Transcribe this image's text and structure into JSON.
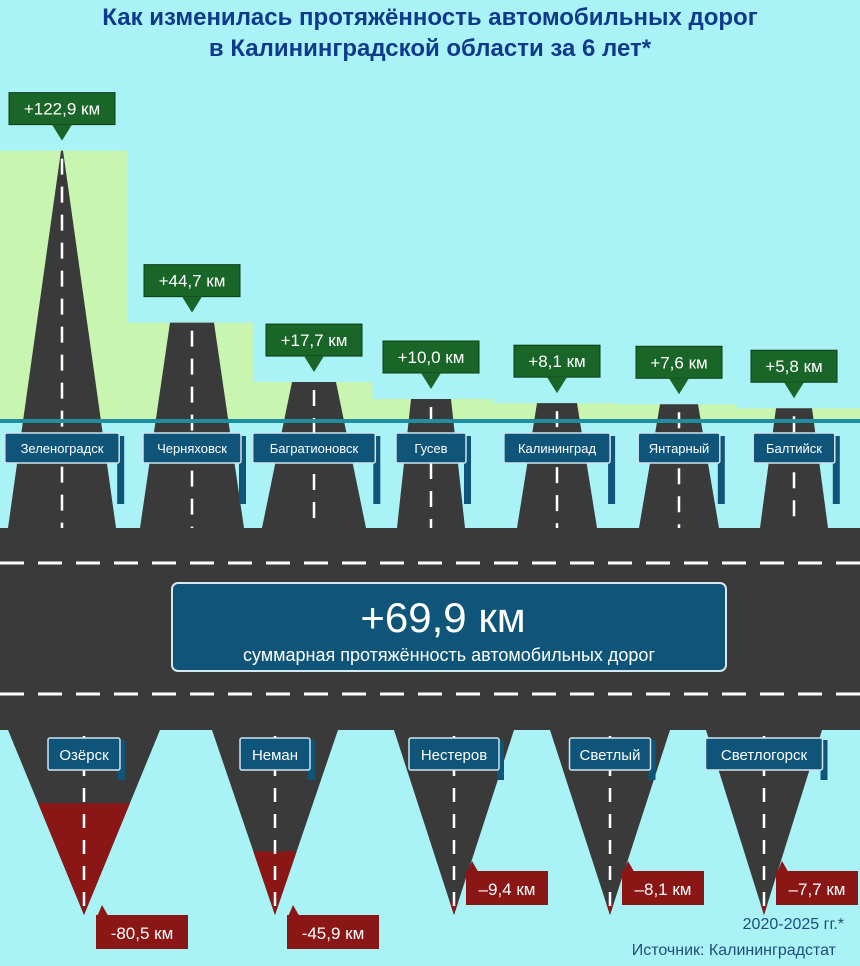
{
  "title_line1": "Как изменилась протяжённость автомобильных дорог",
  "title_line2": "в Калининградской области за 6 лет*",
  "total": {
    "value": "+69,9 км",
    "label": "суммарная протяжённость автомобильных дорог"
  },
  "colors": {
    "background": "#a9f3f7",
    "growth_area": "#c8f5b0",
    "road": "#3a3a3a",
    "positive_label": "#1a6628",
    "negative_label": "#8a1616",
    "sign": "#0f5579",
    "baseline": "#1e8fa0"
  },
  "chart_data": {
    "type": "bar",
    "unit": "км",
    "period": "2020-2025 гг.*",
    "increases": [
      {
        "city": "Зеленоградск",
        "value": 122.9,
        "label": "+122,9 км"
      },
      {
        "city": "Черняховск",
        "value": 44.7,
        "label": "+44,7 км"
      },
      {
        "city": "Багратионовск",
        "value": 17.7,
        "label": "+17,7 км"
      },
      {
        "city": "Гусев",
        "value": 10.0,
        "label": "+10,0 км"
      },
      {
        "city": "Калининград",
        "value": 8.1,
        "label": "+8,1 км"
      },
      {
        "city": "Янтарный",
        "value": 7.6,
        "label": "+7,6 км"
      },
      {
        "city": "Балтийск",
        "value": 5.8,
        "label": "+5,8 км"
      }
    ],
    "decreases": [
      {
        "city": "Озёрск",
        "value": -80.5,
        "label": "-80,5 км"
      },
      {
        "city": "Неман",
        "value": -45.9,
        "label": "-45,9 км"
      },
      {
        "city": "Нестеров",
        "value": -9.4,
        "label": "–9,4 км"
      },
      {
        "city": "Светлый",
        "value": -8.1,
        "label": "–8,1 км"
      },
      {
        "city": "Светлогорск",
        "value": -7.7,
        "label": "–7,7 км"
      }
    ]
  },
  "footer": {
    "period": "2020-2025 гг.*",
    "source": "Источник: Калининградстат"
  }
}
